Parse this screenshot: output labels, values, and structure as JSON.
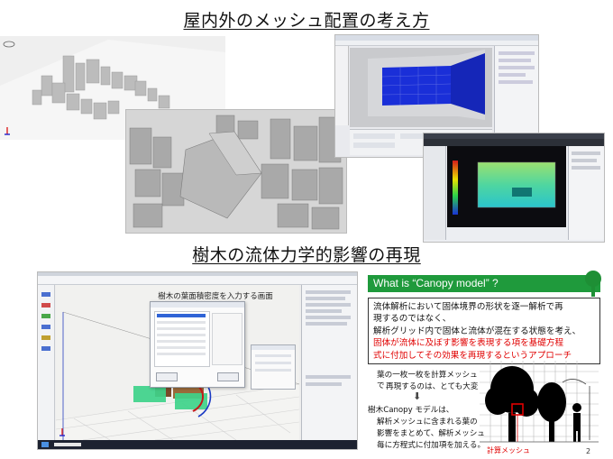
{
  "titles": {
    "top": "屋内外のメッシュ配置の考え方",
    "middle": "樹木の流体力学的影響の再現"
  },
  "colors": {
    "accent_green": "#1f9a3c",
    "highlight_red": "#e00000",
    "room_blue": "#1a2fd8",
    "tree_box_green": "#3ed38a"
  },
  "dialog": {
    "title": "樹木の葉面積密度を入力する画面"
  },
  "canopy": {
    "heading": "What is “Canopy model” ?",
    "line1": "流体解析において固体境界の形状を逐一解析で再",
    "line2": "現するのではなく、",
    "line3": "解析グリッド内で固体と流体が混在する状態を考え、",
    "line4": "固体が流体に及ぼす影響を表現する項を基礎方程",
    "line5": "式に付加してその効果を再現するというアプローチ",
    "note1": "葉の一枚一枚を計算メッシュで",
    "note2": "再現するのは、とても大変",
    "arrow": "⬇",
    "sub1": "樹木Canopy モデルは、",
    "sub2": "解析メッシュに含まれる葉の",
    "sub3": "影響をまとめて、解析メッシュ",
    "sub4": "毎に方程式に付加項を加える。",
    "mesh_label": "計算メッシュ"
  },
  "page_number": "2",
  "icons": [
    "tree-icon",
    "axis-gizmo-icon",
    "arrow-down-icon"
  ]
}
